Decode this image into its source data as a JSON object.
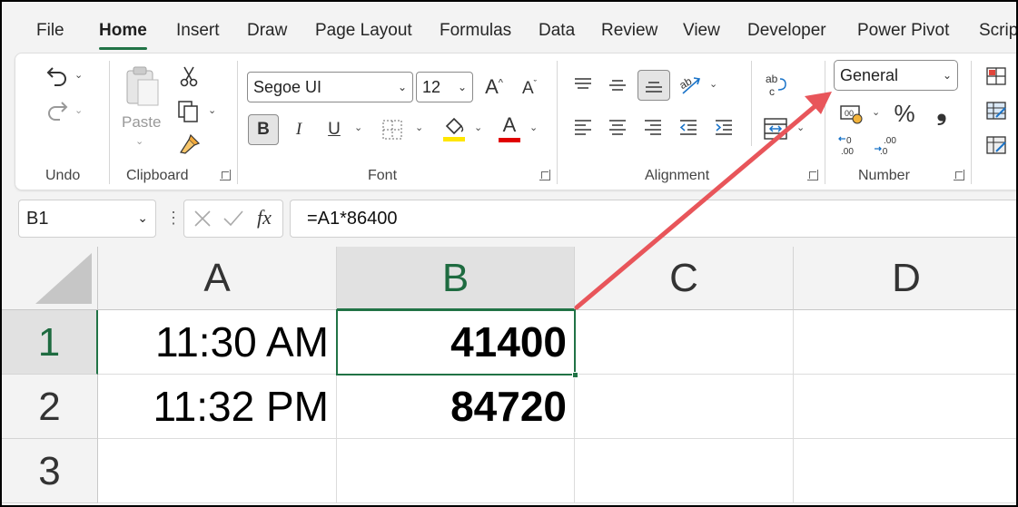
{
  "tabs": [
    "File",
    "Home",
    "Insert",
    "Draw",
    "Page Layout",
    "Formulas",
    "Data",
    "Review",
    "View",
    "Developer",
    "Power Pivot",
    "Scrip"
  ],
  "active_tab": "Home",
  "ribbon": {
    "undo": {
      "label": "Undo"
    },
    "clipboard": {
      "label": "Clipboard",
      "paste_label": "Paste"
    },
    "font": {
      "label": "Font",
      "font_name": "Segoe UI",
      "font_size": "12",
      "bold": "B",
      "italic": "I",
      "underline": "U",
      "font_color_letter": "A"
    },
    "alignment": {
      "label": "Alignment"
    },
    "number": {
      "label": "Number",
      "format": "General",
      "percent": "%",
      "comma": "౿"
    }
  },
  "formula_bar": {
    "name_box": "B1",
    "fx": "fx",
    "formula": "=A1*86400"
  },
  "grid": {
    "columns": [
      "A",
      "B",
      "C",
      "D"
    ],
    "rows": [
      "1",
      "2",
      "3"
    ],
    "cells": {
      "A1": "11:30 AM",
      "A2": "11:32 PM",
      "B1": "41400",
      "B2": "84720"
    }
  },
  "colors": {
    "accent": "#217346",
    "arrow": "#e8555a",
    "fill_highlight": "#ffe600",
    "font_red": "#e00000"
  }
}
